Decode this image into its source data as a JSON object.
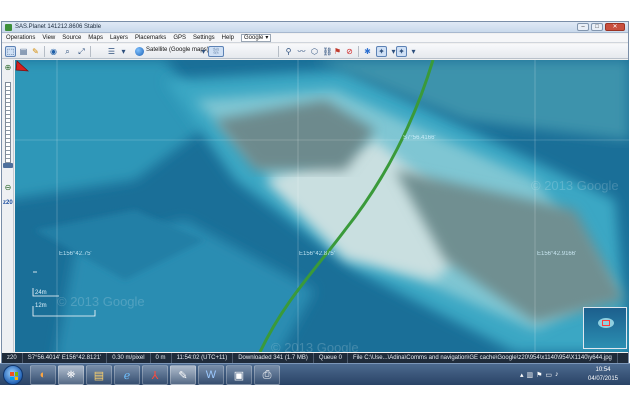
{
  "window": {
    "title": "SAS.Planet 141212.8606 Stable",
    "buttons": {
      "minimize": "–",
      "maximize": "□",
      "close": "✕"
    }
  },
  "menu": {
    "items": [
      "Operations",
      "View",
      "Source",
      "Maps",
      "Layers",
      "Placemarks",
      "GPS",
      "Settings",
      "Help"
    ],
    "search_provider": "Google"
  },
  "toolbar": {
    "map_type": "Satellite (Google maps)",
    "icons": [
      "select-rect-icon",
      "edit-icon",
      "layers-icon",
      "globe-icon",
      "zoom-icon",
      "fullscreen-icon",
      "map-source-icon",
      "placemark-icon",
      "path-icon",
      "polygon-icon",
      "add-icon",
      "no-entry-icon",
      "star-icon",
      "fav-pin-icon",
      "fav-pin-2-icon"
    ]
  },
  "leftbar": {
    "zoom_label": "z20"
  },
  "map": {
    "grid_labels": {
      "top": "S7°56.4166'",
      "left": "E156°42.75'",
      "center": "E156°42.875'",
      "right": "E156°42.9166'"
    },
    "copyright_left": "© 2013 Google",
    "copyright_right": "© 2013 Google",
    "copyright_bottom": "© 2013 Google",
    "scale": {
      "top": "24m",
      "mid": "12m",
      "bottom_left": "0m",
      "bottom_right": "16m"
    }
  },
  "statusbar": {
    "zoom": "z20",
    "coordinates": "S7°56.4014' E156°42.8121'",
    "resolution": "0.30 m/pixel",
    "altitude": "0 m",
    "time": "11:54:02 (UTC+11)",
    "downloaded": "Downloaded 341 (1.7 MB)",
    "queue": "Queue 0",
    "file": "File C:\\Use...\\Adina\\Comms and navigation\\GE cache\\Google\\z20\\954\\x1140\\954\\X1140\\y644.jpg"
  },
  "taskbar": {
    "apps": [
      "start",
      "firefox",
      "explorer",
      "ie",
      "acrobat",
      "notepad",
      "word",
      "image-viewer",
      "sasplanet"
    ],
    "time": "10:54",
    "date": "04/07/2015"
  },
  "colors": {
    "track": "#3a9a3a",
    "marker": "#d62020",
    "water_deep": "#1b7aa3",
    "reef_light": "#c9dfe0",
    "taskbar": "#2a4366"
  }
}
